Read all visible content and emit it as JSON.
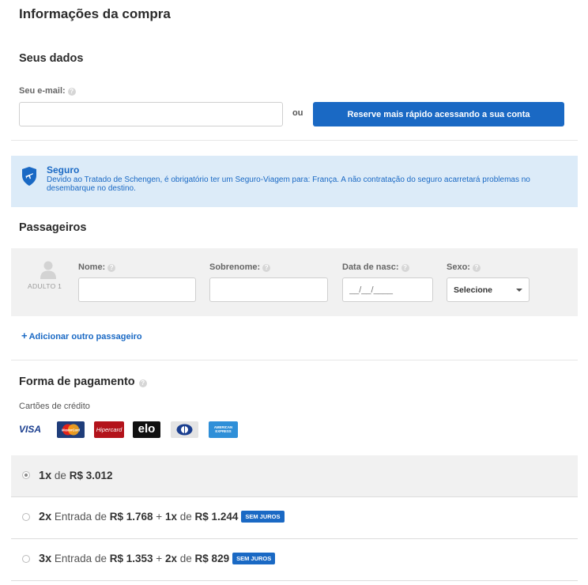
{
  "page_title": "Informações da compra",
  "your_data": {
    "heading": "Seus dados",
    "email_label": "Seu e-mail:",
    "email_value": "",
    "or_text": "ou",
    "login_button": "Reserve mais rápido acessando a sua conta"
  },
  "insurance": {
    "title": "Seguro",
    "text": "Devido ao Tratado de Schengen, é obrigatório ter um Seguro-Viagem para: França. A não contratação do seguro acarretará problemas no desembarque no destino."
  },
  "passengers": {
    "heading": "Passageiros",
    "type_label": "ADULTO 1",
    "name_label": "Nome:",
    "surname_label": "Sobrenome:",
    "birth_label": "Data de nasc:",
    "birth_placeholder": "__/__/____",
    "sex_label": "Sexo:",
    "sex_selected": "Selecione",
    "add_passenger": "Adicionar outro passageiro"
  },
  "payment": {
    "heading": "Forma de pagamento",
    "cards_label": "Cartões de crédito",
    "cards": [
      "visa-icon",
      "mastercard-icon",
      "hipercard-icon",
      "elo-icon",
      "diners-icon",
      "amex-icon"
    ],
    "card_text": {
      "visa": "VISA",
      "mastercard": "MasterCard",
      "hipercard": "Hipercard",
      "elo": "elo",
      "amex": "AMERICAN EXPRESS"
    },
    "options": [
      {
        "count": "1x",
        "prefix": "de",
        "amount": "R$ 3.012",
        "selected": true
      },
      {
        "count": "2x",
        "prefix": "Entrada de",
        "entry": "R$ 1.768",
        "plus": "+",
        "rest_count": "1x",
        "rest_prefix": "de",
        "rest_amount": "R$ 1.244",
        "badge": "SEM JUROS",
        "selected": false
      },
      {
        "count": "3x",
        "prefix": "Entrada de",
        "entry": "R$ 1.353",
        "plus": "+",
        "rest_count": "2x",
        "rest_prefix": "de",
        "rest_amount": "R$ 829",
        "badge": "SEM JUROS",
        "selected": false
      }
    ]
  },
  "colors": {
    "accent": "#1a69c4",
    "insurance_bg": "#dcebf8",
    "panel_bg": "#f1f1f1"
  }
}
